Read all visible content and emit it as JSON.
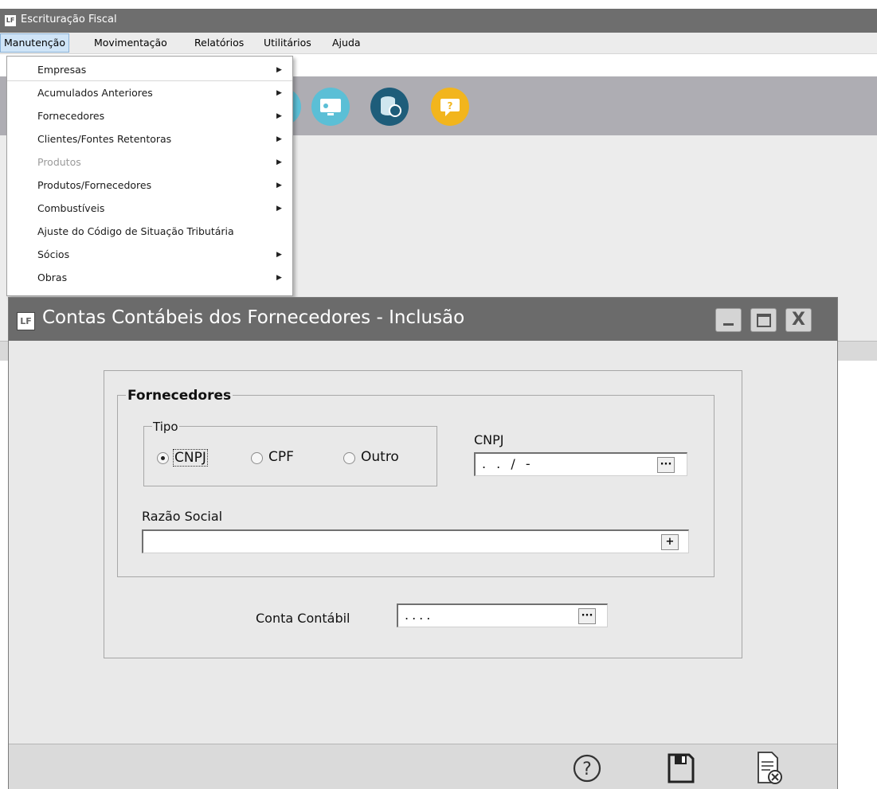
{
  "app": {
    "icon_text": "LF",
    "title": "Escrituração Fiscal"
  },
  "menubar": {
    "items": [
      {
        "label": "Manutenção"
      },
      {
        "label": "Movimentação"
      },
      {
        "label": "Relatórios"
      },
      {
        "label": "Utilitários"
      },
      {
        "label": "Ajuda"
      }
    ]
  },
  "dropdown": {
    "items": [
      {
        "label": "Empresas",
        "submenu": true,
        "disabled": false
      },
      {
        "label": "Acumulados Anteriores",
        "submenu": true,
        "disabled": false
      },
      {
        "label": "Fornecedores",
        "submenu": true,
        "disabled": false
      },
      {
        "label": "Clientes/Fontes Retentoras",
        "submenu": true,
        "disabled": false
      },
      {
        "label": "Produtos",
        "submenu": true,
        "disabled": true
      },
      {
        "label": "Produtos/Fornecedores",
        "submenu": true,
        "disabled": false
      },
      {
        "label": "Combustíveis",
        "submenu": true,
        "disabled": false
      },
      {
        "label": "Ajuste do Código de Situação Tributária",
        "submenu": false,
        "disabled": false
      },
      {
        "label": "Sócios",
        "submenu": true,
        "disabled": false
      },
      {
        "label": "Obras",
        "submenu": true,
        "disabled": false
      }
    ],
    "arrow_glyph": "▶"
  },
  "toolbar": {
    "buttons": [
      {
        "icon": "monitor-icon",
        "color": "#5bbfd6"
      },
      {
        "icon": "database-icon",
        "color": "#1e5d7a"
      },
      {
        "icon": "help-chat-icon",
        "color": "#f2b51d"
      }
    ]
  },
  "dialog": {
    "icon_text": "LF",
    "title": "Contas Contábeis dos Fornecedores - Inclusão",
    "close_glyph": "X",
    "group_title": "Fornecedores",
    "tipo": {
      "legend": "Tipo",
      "options": [
        "CNPJ",
        "CPF",
        "Outro"
      ],
      "selected": "CNPJ"
    },
    "cnpj": {
      "label": "CNPJ",
      "value": " .  .  /  -",
      "button": "···"
    },
    "razao_social": {
      "label": "Razão Social",
      "value": "",
      "button": "+"
    },
    "conta_contabil": {
      "label": "Conta Contábil",
      "value": "....",
      "button": "···"
    },
    "footer": {
      "help_glyph": "?",
      "save_icon": "floppy-disk-icon",
      "cancel_icon": "document-cancel-icon"
    }
  },
  "colors": {
    "title_bar": "#6b6b6b",
    "toolbar_bg": "#aeadb3",
    "dialog_bg": "#e9e9e9"
  }
}
